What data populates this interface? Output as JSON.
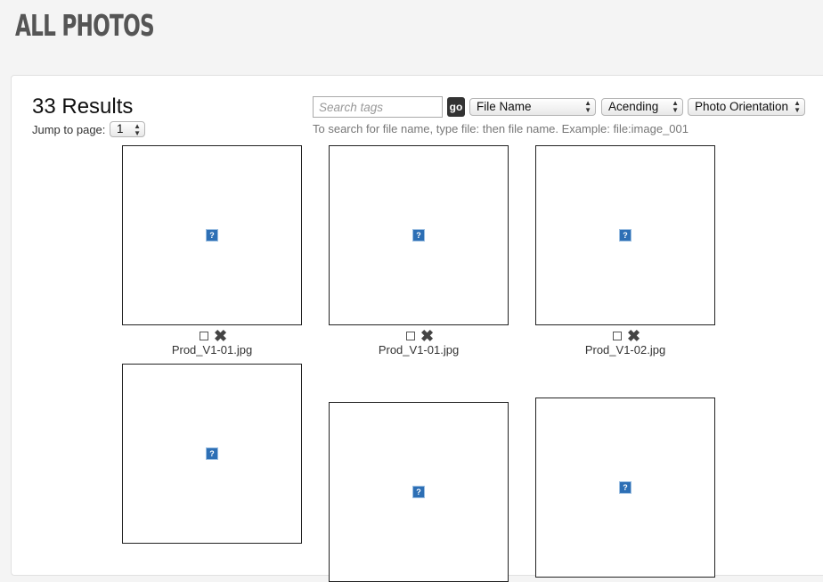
{
  "page": {
    "title": "ALL PHOTOS"
  },
  "results": {
    "count_label": "33 Results"
  },
  "pagination": {
    "label": "Jump to page:",
    "current_page": "1"
  },
  "search": {
    "placeholder": "Search tags",
    "value": "",
    "go_label": "go",
    "hint": "To search for file name, type file: then file name. Example: file:image_001"
  },
  "filters": {
    "sort_field": "File Name",
    "sort_order": "Acending",
    "orientation": "Photo Orientation"
  },
  "photos": [
    {
      "file_name": "Prod_V1-01.jpg"
    },
    {
      "file_name": "Prod_V1-01.jpg"
    },
    {
      "file_name": "Prod_V1-02.jpg"
    },
    {
      "file_name": ""
    },
    {
      "file_name": ""
    },
    {
      "file_name": ""
    }
  ],
  "icons": {
    "delete": "delete-icon",
    "broken_image": "broken-image-icon",
    "select": "select-checkbox",
    "dropdown": "dropdown-arrows-icon"
  }
}
